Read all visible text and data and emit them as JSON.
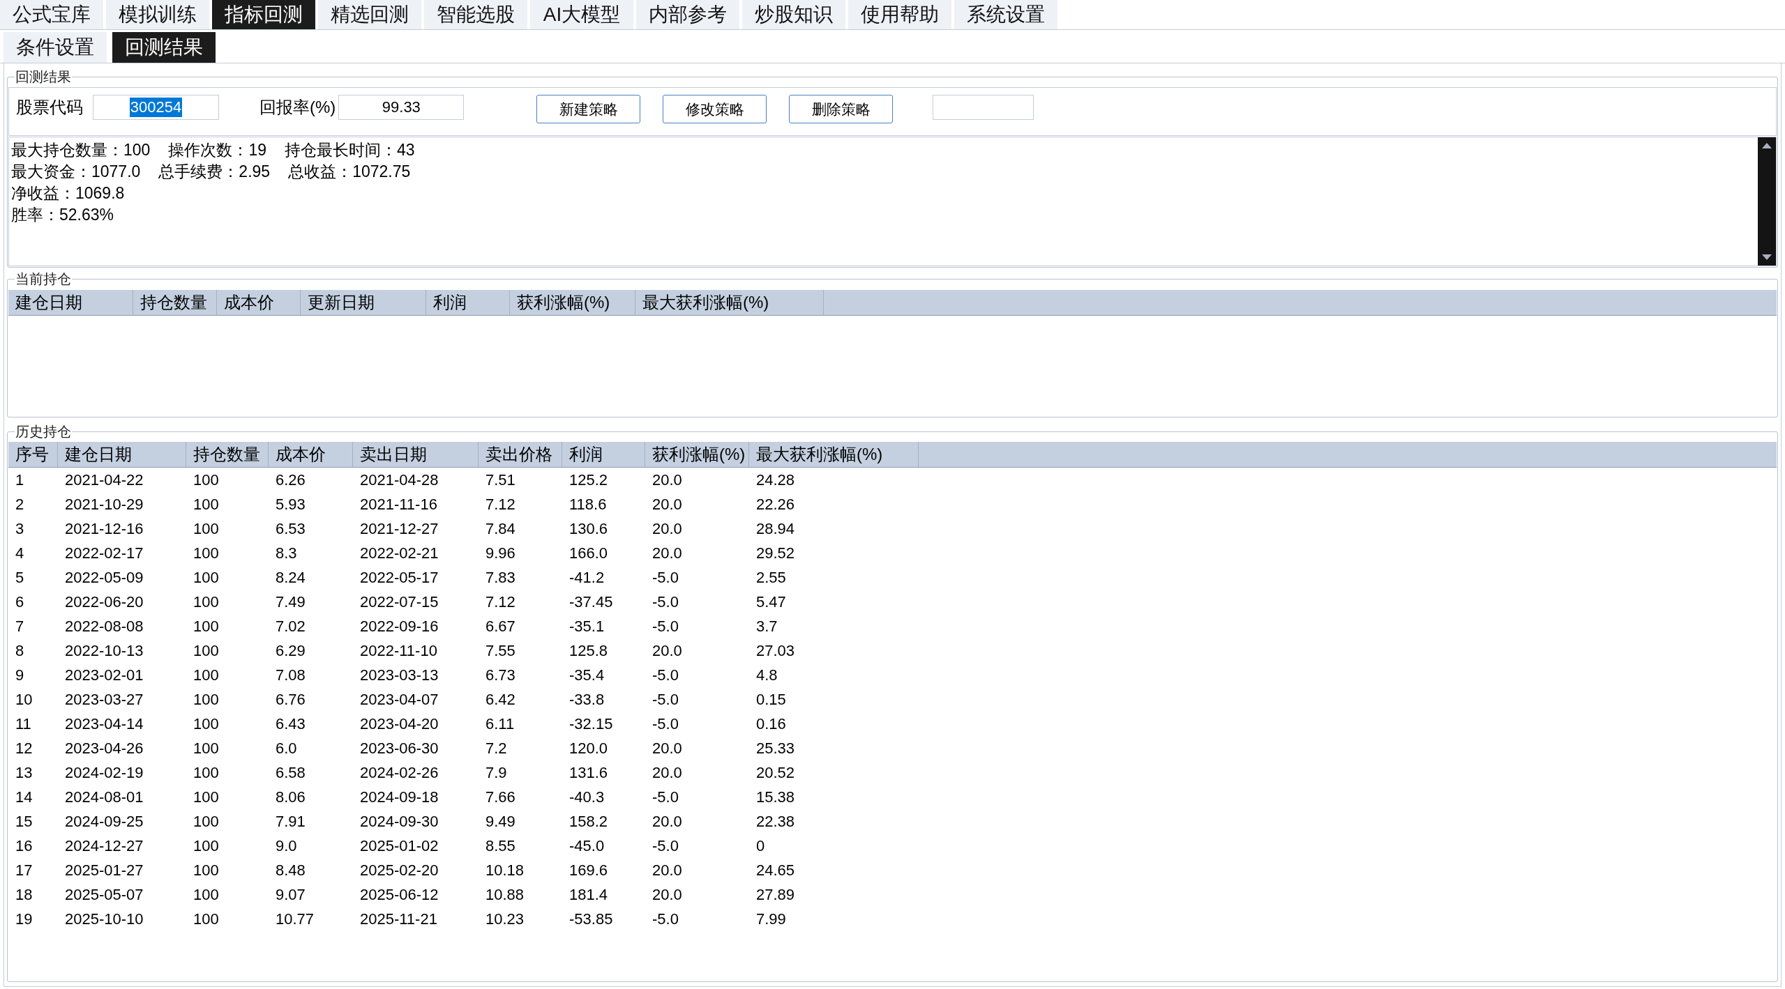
{
  "main_tabs": [
    {
      "label": "公式宝库",
      "selected": false
    },
    {
      "label": "模拟训练",
      "selected": false
    },
    {
      "label": "指标回测",
      "selected": true
    },
    {
      "label": "精选回测",
      "selected": false
    },
    {
      "label": "智能选股",
      "selected": false
    },
    {
      "label": "AI大模型",
      "selected": false
    },
    {
      "label": "内部参考",
      "selected": false
    },
    {
      "label": "炒股知识",
      "selected": false
    },
    {
      "label": "使用帮助",
      "selected": false
    },
    {
      "label": "系统设置",
      "selected": false
    }
  ],
  "sub_tabs": [
    {
      "label": "条件设置",
      "selected": false
    },
    {
      "label": "回测结果",
      "selected": true
    }
  ],
  "result_panel": {
    "title": "回测结果",
    "stock_code": {
      "label": "股票代码",
      "value": "300254",
      "value_selected": true
    },
    "return_rate": {
      "label": "回报率(%)",
      "value": "99.33"
    },
    "buttons": [
      "新建策略",
      "修改策略",
      "删除策略"
    ],
    "summary_lines": [
      [
        "最大持仓数量：100",
        "操作次数：19",
        "持仓最长时间：43"
      ],
      [
        "最大资金：1077.0",
        "总手续费：2.95",
        "总收益：1072.75"
      ],
      [
        "净收益：1069.8"
      ],
      [
        "胜率：52.63%"
      ]
    ]
  },
  "current_positions": {
    "title": "当前持仓",
    "columns": [
      "建仓日期",
      "持仓数量",
      "成本价",
      "更新日期",
      "利润",
      "获利涨幅(%)",
      "最大获利涨幅(%)"
    ]
  },
  "history": {
    "title": "历史持仓",
    "columns": [
      "序号",
      "建仓日期",
      "持仓数量",
      "成本价",
      "卖出日期",
      "卖出价格",
      "利润",
      "获利涨幅(%)",
      "最大获利涨幅(%)"
    ],
    "rows": [
      [
        "1",
        "2021-04-22",
        "100",
        "6.26",
        "2021-04-28",
        "7.51",
        "125.2",
        "20.0",
        "24.28"
      ],
      [
        "2",
        "2021-10-29",
        "100",
        "5.93",
        "2021-11-16",
        "7.12",
        "118.6",
        "20.0",
        "22.26"
      ],
      [
        "3",
        "2021-12-16",
        "100",
        "6.53",
        "2021-12-27",
        "7.84",
        "130.6",
        "20.0",
        "28.94"
      ],
      [
        "4",
        "2022-02-17",
        "100",
        "8.3",
        "2022-02-21",
        "9.96",
        "166.0",
        "20.0",
        "29.52"
      ],
      [
        "5",
        "2022-05-09",
        "100",
        "8.24",
        "2022-05-17",
        "7.83",
        "-41.2",
        "-5.0",
        "2.55"
      ],
      [
        "6",
        "2022-06-20",
        "100",
        "7.49",
        "2022-07-15",
        "7.12",
        "-37.45",
        "-5.0",
        "5.47"
      ],
      [
        "7",
        "2022-08-08",
        "100",
        "7.02",
        "2022-09-16",
        "6.67",
        "-35.1",
        "-5.0",
        "3.7"
      ],
      [
        "8",
        "2022-10-13",
        "100",
        "6.29",
        "2022-11-10",
        "7.55",
        "125.8",
        "20.0",
        "27.03"
      ],
      [
        "9",
        "2023-02-01",
        "100",
        "7.08",
        "2023-03-13",
        "6.73",
        "-35.4",
        "-5.0",
        "4.8"
      ],
      [
        "10",
        "2023-03-27",
        "100",
        "6.76",
        "2023-04-07",
        "6.42",
        "-33.8",
        "-5.0",
        "0.15"
      ],
      [
        "11",
        "2023-04-14",
        "100",
        "6.43",
        "2023-04-20",
        "6.11",
        "-32.15",
        "-5.0",
        "0.16"
      ],
      [
        "12",
        "2023-04-26",
        "100",
        "6.0",
        "2023-06-30",
        "7.2",
        "120.0",
        "20.0",
        "25.33"
      ],
      [
        "13",
        "2024-02-19",
        "100",
        "6.58",
        "2024-02-26",
        "7.9",
        "131.6",
        "20.0",
        "20.52"
      ],
      [
        "14",
        "2024-08-01",
        "100",
        "8.06",
        "2024-09-18",
        "7.66",
        "-40.3",
        "-5.0",
        "15.38"
      ],
      [
        "15",
        "2024-09-25",
        "100",
        "7.91",
        "2024-09-30",
        "9.49",
        "158.2",
        "20.0",
        "22.38"
      ],
      [
        "16",
        "2024-12-27",
        "100",
        "9.0",
        "2025-01-02",
        "8.55",
        "-45.0",
        "-5.0",
        "0"
      ],
      [
        "17",
        "2025-01-27",
        "100",
        "8.48",
        "2025-02-20",
        "10.18",
        "169.6",
        "20.0",
        "24.65"
      ],
      [
        "18",
        "2025-05-07",
        "100",
        "9.07",
        "2025-06-12",
        "10.88",
        "181.4",
        "20.0",
        "27.89"
      ],
      [
        "19",
        "2025-10-10",
        "100",
        "10.77",
        "2025-11-21",
        "10.23",
        "-53.85",
        "-5.0",
        "7.99"
      ]
    ]
  }
}
